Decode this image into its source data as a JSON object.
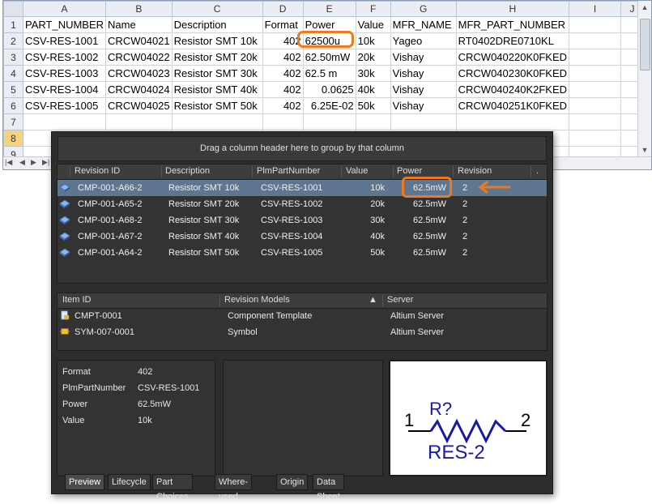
{
  "spreadsheet": {
    "column_headers": [
      "A",
      "B",
      "C",
      "D",
      "E",
      "F",
      "G",
      "H",
      "I",
      "J"
    ],
    "row_numbers": [
      "1",
      "2",
      "3",
      "4",
      "5",
      "6",
      "7",
      "8",
      "9"
    ],
    "rows": [
      [
        "PART_NUMBER",
        "Name",
        "Description",
        "Format",
        "Power",
        "Value",
        "MFR_NAME",
        "MFR_PART_NUMBER",
        "",
        ""
      ],
      [
        "CSV-RES-1001",
        "CRCW04021",
        "Resistor SMT 10k",
        "402",
        "62500u",
        "10k",
        "Yageo",
        "RT0402DRE0710KL",
        "",
        ""
      ],
      [
        "CSV-RES-1002",
        "CRCW04022",
        "Resistor SMT 20k",
        "402",
        "62.50mW",
        "20k",
        "Vishay",
        "CRCW040220K0FKED",
        "",
        ""
      ],
      [
        "CSV-RES-1003",
        "CRCW04023",
        "Resistor SMT 30k",
        "402",
        "62.5 m",
        "30k",
        "Vishay",
        "CRCW040230K0FKED",
        "",
        ""
      ],
      [
        "CSV-RES-1004",
        "CRCW04024",
        "Resistor SMT 40k",
        "402",
        "0.0625",
        "40k",
        "Vishay",
        "CRCW040240K2FKED",
        "",
        ""
      ],
      [
        "CSV-RES-1005",
        "CRCW04025",
        "Resistor SMT 50k",
        "402",
        "6.25E-02",
        "50k",
        "Vishay",
        "CRCW040251K0FKED",
        "",
        ""
      ],
      [
        "",
        "",
        "",
        "",
        "",
        "",
        "",
        "",
        "",
        ""
      ],
      [
        "",
        "",
        "",
        "",
        "",
        "",
        "",
        "",
        "",
        ""
      ],
      [
        "",
        "",
        "",
        "",
        "",
        "",
        "",
        "",
        "",
        ""
      ]
    ],
    "highlight_color": "#ee7a1f",
    "selected_row": "8"
  },
  "panel": {
    "group_hint": "Drag a column header here to group by that column",
    "revisions": {
      "headers": [
        "Revision ID",
        "Description",
        "PlmPartNumber",
        "Value",
        "Power",
        "Revision"
      ],
      "rows": [
        {
          "id": "CMP-001-A66-2",
          "description": "Resistor SMT 10k",
          "plm": "CSV-RES-1001",
          "value": "10k",
          "power": "62.5mW",
          "revision": "2"
        },
        {
          "id": "CMP-001-A65-2",
          "description": "Resistor SMT 20k",
          "plm": "CSV-RES-1002",
          "value": "20k",
          "power": "62.5mW",
          "revision": "2"
        },
        {
          "id": "CMP-001-A68-2",
          "description": "Resistor SMT 30k",
          "plm": "CSV-RES-1003",
          "value": "30k",
          "power": "62.5mW",
          "revision": "2"
        },
        {
          "id": "CMP-001-A67-2",
          "description": "Resistor SMT 40k",
          "plm": "CSV-RES-1004",
          "value": "40k",
          "power": "62.5mW",
          "revision": "2"
        },
        {
          "id": "CMP-001-A64-2",
          "description": "Resistor SMT 50k",
          "plm": "CSV-RES-1005",
          "value": "50k",
          "power": "62.5mW",
          "revision": "2"
        }
      ]
    },
    "items": {
      "headers": [
        "Item ID",
        "Revision Models",
        "Server"
      ],
      "rows": [
        {
          "id": "CMPT-0001",
          "model": "Component Template",
          "server": "Altium Server"
        },
        {
          "id": "SYM-007-0001",
          "model": "Symbol",
          "server": "Altium Server"
        }
      ]
    },
    "properties": [
      {
        "name": "Format",
        "value": "402"
      },
      {
        "name": "PlmPartNumber",
        "value": "CSV-RES-1001"
      },
      {
        "name": "Power",
        "value": "62.5mW"
      },
      {
        "name": "Value",
        "value": "10k"
      }
    ],
    "symbol": {
      "designator": "R?",
      "comment": "RES-2",
      "pin1": "1",
      "pin2": "2",
      "color": "#1a1aa6"
    },
    "tabs": [
      "Preview",
      "Lifecycle",
      "Part Choices",
      "Where-used",
      "Origin",
      "Data Sheet"
    ],
    "active_tab": "Preview",
    "icons": {
      "revision": "component-icon",
      "template": "template-icon",
      "symbol": "symbol-icon",
      "arrow": "arrow-left-icon"
    }
  }
}
